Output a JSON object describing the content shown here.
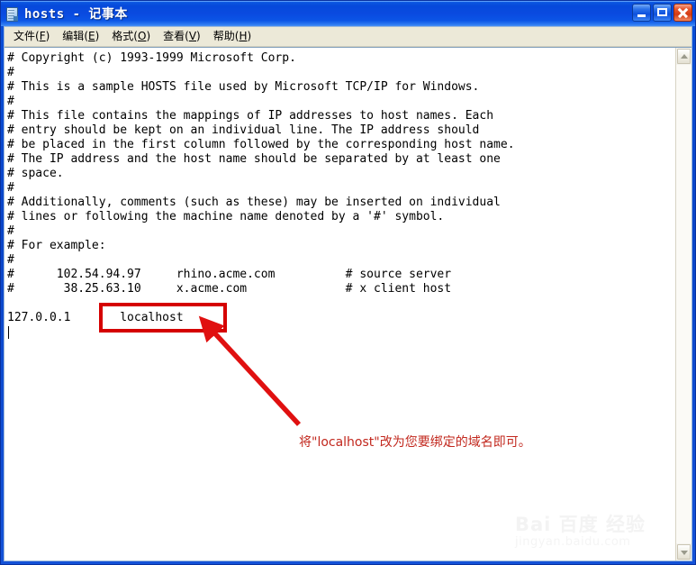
{
  "window": {
    "title": "hosts - 记事本",
    "icon": "notepad-document-icon",
    "accent_color": "#0a4fd8",
    "buttons": {
      "minimize": "最小化",
      "maximize": "最大化",
      "close": "关闭"
    }
  },
  "menubar": {
    "items": [
      {
        "label": "文件",
        "accel": "F"
      },
      {
        "label": "编辑",
        "accel": "E"
      },
      {
        "label": "格式",
        "accel": "O"
      },
      {
        "label": "查看",
        "accel": "V"
      },
      {
        "label": "帮助",
        "accel": "H"
      }
    ]
  },
  "editor": {
    "lines": [
      "# Copyright (c) 1993-1999 Microsoft Corp.",
      "#",
      "# This is a sample HOSTS file used by Microsoft TCP/IP for Windows.",
      "#",
      "# This file contains the mappings of IP addresses to host names. Each",
      "# entry should be kept on an individual line. The IP address should",
      "# be placed in the first column followed by the corresponding host name.",
      "# The IP address and the host name should be separated by at least one",
      "# space.",
      "#",
      "# Additionally, comments (such as these) may be inserted on individual",
      "# lines or following the machine name denoted by a '#' symbol.",
      "#",
      "# For example:",
      "#",
      "#      102.54.94.97     rhino.acme.com          # source server",
      "#       38.25.63.10     x.acme.com              # x client host",
      "",
      "127.0.0.1       localhost",
      ""
    ],
    "caret_line": 19
  },
  "scrollbar": {
    "up_arrow": "scroll-up-icon",
    "down_arrow": "scroll-down-icon"
  },
  "annotation": {
    "text": "将\"localhost\"改为您要绑定的域名即可。",
    "color": "#c2281e",
    "box_color": "#d50000",
    "highlighted_value": "localhost"
  },
  "watermark": {
    "top": "Bai 百度 经验",
    "bottom": "jingyan.baidu.com"
  }
}
